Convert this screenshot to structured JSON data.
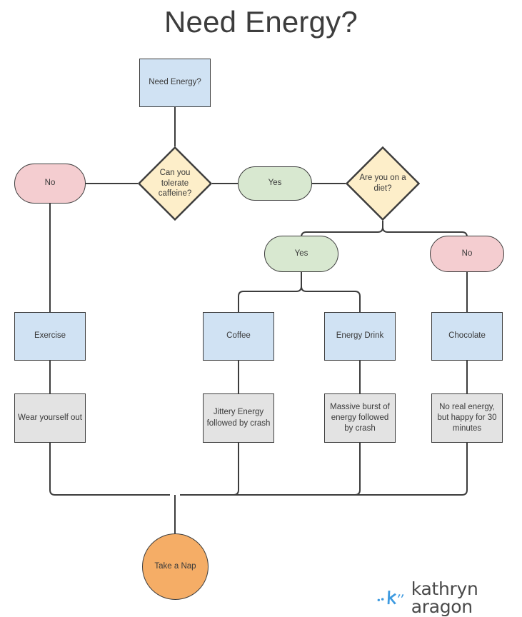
{
  "title": "Need Energy?",
  "colors": {
    "box_blue": "#d0e2f3",
    "box_gray": "#e3e3e3",
    "pill_pink": "#f4cdd0",
    "pill_green": "#d8e8d0",
    "diamond_cream": "#fdeec9",
    "circle_orange": "#f5ad66",
    "stroke": "#3c3c3c",
    "text": "#3a3a3a",
    "logo_blue": "#3d9ae0",
    "logo_text": "#4a4a4a",
    "background": "#ffffff"
  },
  "nodes": {
    "start": {
      "label": "Need Energy?",
      "shape": "rect",
      "fill": "box_blue"
    },
    "caffeine_q": {
      "label_line1": "Can you",
      "label_line2": "tolerate",
      "label_line3": "caffeine?",
      "shape": "diamond",
      "fill": "diamond_cream"
    },
    "caffeine_no": {
      "label": "No",
      "shape": "pill",
      "fill": "pill_pink"
    },
    "caffeine_yes": {
      "label": "Yes",
      "shape": "pill",
      "fill": "pill_green"
    },
    "diet_q": {
      "label_line1": "Are you on a",
      "label_line2": "diet?",
      "shape": "diamond",
      "fill": "diamond_cream"
    },
    "diet_yes": {
      "label": "Yes",
      "shape": "pill",
      "fill": "pill_green"
    },
    "diet_no": {
      "label": "No",
      "shape": "pill",
      "fill": "pill_pink"
    },
    "exercise": {
      "label": "Exercise",
      "shape": "rect",
      "fill": "box_blue"
    },
    "coffee": {
      "label": "Coffee",
      "shape": "rect",
      "fill": "box_blue"
    },
    "energy_drink": {
      "label": "Energy Drink",
      "shape": "rect",
      "fill": "box_blue"
    },
    "chocolate": {
      "label": "Chocolate",
      "shape": "rect",
      "fill": "box_blue"
    },
    "exercise_outcome": {
      "label": "Wear yourself out",
      "shape": "rect",
      "fill": "box_gray"
    },
    "coffee_outcome": {
      "label": "Jittery Energy followed by crash",
      "shape": "rect",
      "fill": "box_gray"
    },
    "energy_drink_outcome": {
      "label": "Massive burst of energy followed by crash",
      "shape": "rect",
      "fill": "box_gray"
    },
    "chocolate_outcome": {
      "label": "No real energy, but happy for 30 minutes",
      "shape": "rect",
      "fill": "box_gray"
    },
    "end": {
      "label": "Take a Nap",
      "shape": "circle",
      "fill": "circle_orange"
    }
  },
  "logo": {
    "mark": "stylized-k-icon",
    "text": "kathryn aragon"
  }
}
